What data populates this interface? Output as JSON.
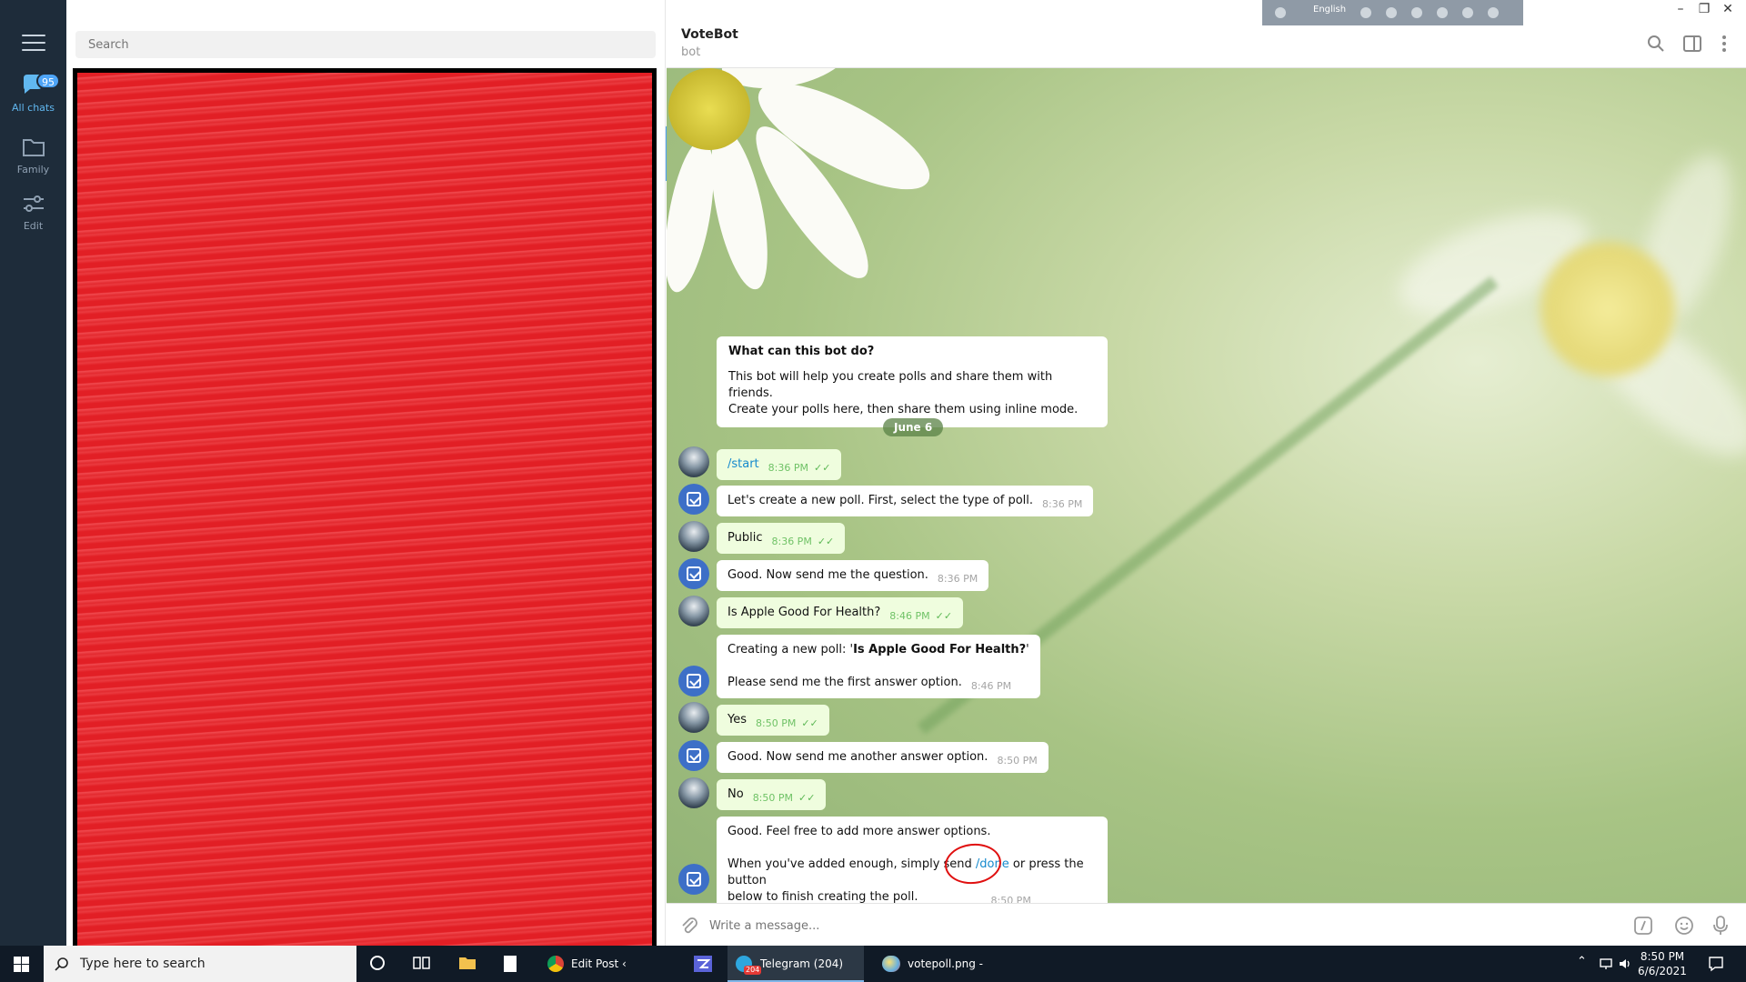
{
  "rail": {
    "all_chats_label": "All chats",
    "all_chats_badge": "95",
    "family_label": "Family",
    "edit_label": "Edit"
  },
  "search": {
    "placeholder": "Search"
  },
  "chat": {
    "title": "VoteBot",
    "subtitle": "bot",
    "date_separator": "June 6",
    "intro": {
      "heading": "What can this bot do?",
      "line1": "This bot will help you create polls and share them with friends.",
      "line2": "Create your polls here, then share them using inline mode."
    },
    "messages": [
      {
        "dir": "out",
        "text": "/start",
        "time": "8:36 PM"
      },
      {
        "dir": "in",
        "text": "Let's create a new poll. First, select the type of poll.",
        "time": "8:36 PM"
      },
      {
        "dir": "out",
        "text": "Public",
        "time": "8:36 PM"
      },
      {
        "dir": "in",
        "text": "Good. Now send me the question.",
        "time": "8:36 PM"
      },
      {
        "dir": "out",
        "text": "Is Apple Good For Health?",
        "time": "8:46 PM"
      },
      {
        "dir": "in",
        "text_prefix": "Creating a new poll: '",
        "text_bold": "Is Apple Good For Health?",
        "text_suffix": "'",
        "text2": "Please send me the first answer option.",
        "time": "8:46 PM"
      },
      {
        "dir": "out",
        "text": "Yes",
        "time": "8:50 PM"
      },
      {
        "dir": "in",
        "text": "Good. Now send me another answer option.",
        "time": "8:50 PM"
      },
      {
        "dir": "out",
        "text": "No",
        "time": "8:50 PM"
      },
      {
        "dir": "in",
        "text": "Good. Feel free to add more answer options.",
        "text2_prefix": "When you've added enough, simply send ",
        "text2_cmd": "/done",
        "text2_suffix": " or press the button",
        "text3": "below to finish creating the poll.",
        "time": "8:50 PM"
      }
    ],
    "compose_placeholder": "Write a message..."
  },
  "language_bar": {
    "label": "English"
  },
  "taskbar": {
    "search_placeholder": "Type here to search",
    "apps": [
      {
        "label": "Edit Post ‹ Telegra..."
      },
      {
        "label": "Telegram (204)"
      },
      {
        "label": "votepoll.png - Paint"
      }
    ],
    "telegram_badge": "204",
    "time": "8:50 PM",
    "date": "6/6/2021"
  },
  "colors": {
    "rail_bg": "#1e2c3a",
    "accent": "#4ea4f6",
    "out_bubble": "#effdde",
    "redaction": "#e21f25"
  }
}
